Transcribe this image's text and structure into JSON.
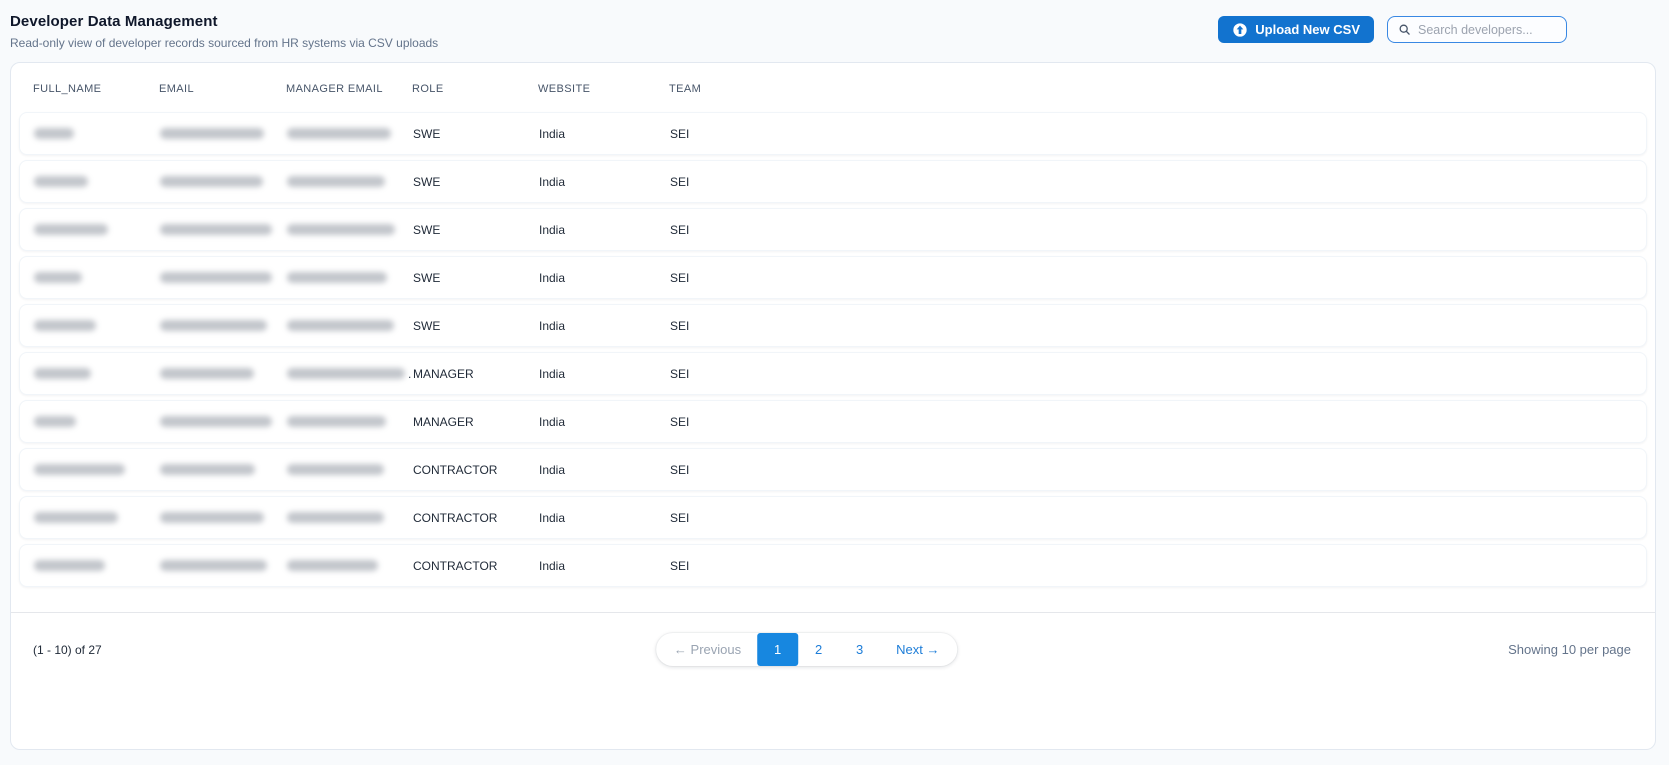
{
  "header": {
    "title": "Developer Data Management",
    "subtitle": "Read-only view of developer records sourced from HR systems via CSV uploads",
    "upload_button_label": "Upload New CSV",
    "search_placeholder": "Search developers..."
  },
  "colors": {
    "page_background": "#f8fafc",
    "upload_button_blue": "#1273cf",
    "search_border_blue": "#3988e3",
    "active_page_blue": "#1787e0",
    "pagination_link_blue": "#1d7dd8",
    "card_border": "#e2e8f0"
  },
  "table": {
    "columns": [
      "FULL_NAME",
      "EMAIL",
      "MANAGER EMAIL",
      "ROLE",
      "WEBSITE",
      "TEAM"
    ],
    "rows": [
      {
        "role": "SWE",
        "website": "India",
        "team": "SEI",
        "redacted": {
          "full_name": 40,
          "email": 104,
          "manager_email": 104
        }
      },
      {
        "role": "SWE",
        "website": "India",
        "team": "SEI",
        "redacted": {
          "full_name": 54,
          "email": 103,
          "manager_email": 98
        }
      },
      {
        "role": "SWE",
        "website": "India",
        "team": "SEI",
        "redacted": {
          "full_name": 74,
          "email": 112,
          "manager_email": 108
        }
      },
      {
        "role": "SWE",
        "website": "India",
        "team": "SEI",
        "redacted": {
          "full_name": 48,
          "email": 112,
          "manager_email": 100
        }
      },
      {
        "role": "SWE",
        "website": "India",
        "team": "SEI",
        "redacted": {
          "full_name": 62,
          "email": 107,
          "manager_email": 107
        }
      },
      {
        "role": "MANAGER",
        "website": "India",
        "team": "SEI",
        "redacted": {
          "full_name": 57,
          "email": 94,
          "manager_email": 118
        },
        "manager_suffix": "."
      },
      {
        "role": "MANAGER",
        "website": "India",
        "team": "SEI",
        "redacted": {
          "full_name": 42,
          "email": 112,
          "manager_email": 99
        }
      },
      {
        "role": "CONTRACTOR",
        "website": "India",
        "team": "SEI",
        "redacted": {
          "full_name": 91,
          "email": 95,
          "manager_email": 97
        }
      },
      {
        "role": "CONTRACTOR",
        "website": "India",
        "team": "SEI",
        "redacted": {
          "full_name": 84,
          "email": 104,
          "manager_email": 97
        }
      },
      {
        "role": "CONTRACTOR",
        "website": "India",
        "team": "SEI",
        "redacted": {
          "full_name": 71,
          "email": 107,
          "manager_email": 91
        }
      }
    ]
  },
  "footer": {
    "range_text": "(1 - 10) of 27",
    "previous_label": "← Previous",
    "pages": [
      "1",
      "2",
      "3"
    ],
    "active_page": "1",
    "next_label": "Next →",
    "per_page_text": "Showing 10 per page"
  }
}
